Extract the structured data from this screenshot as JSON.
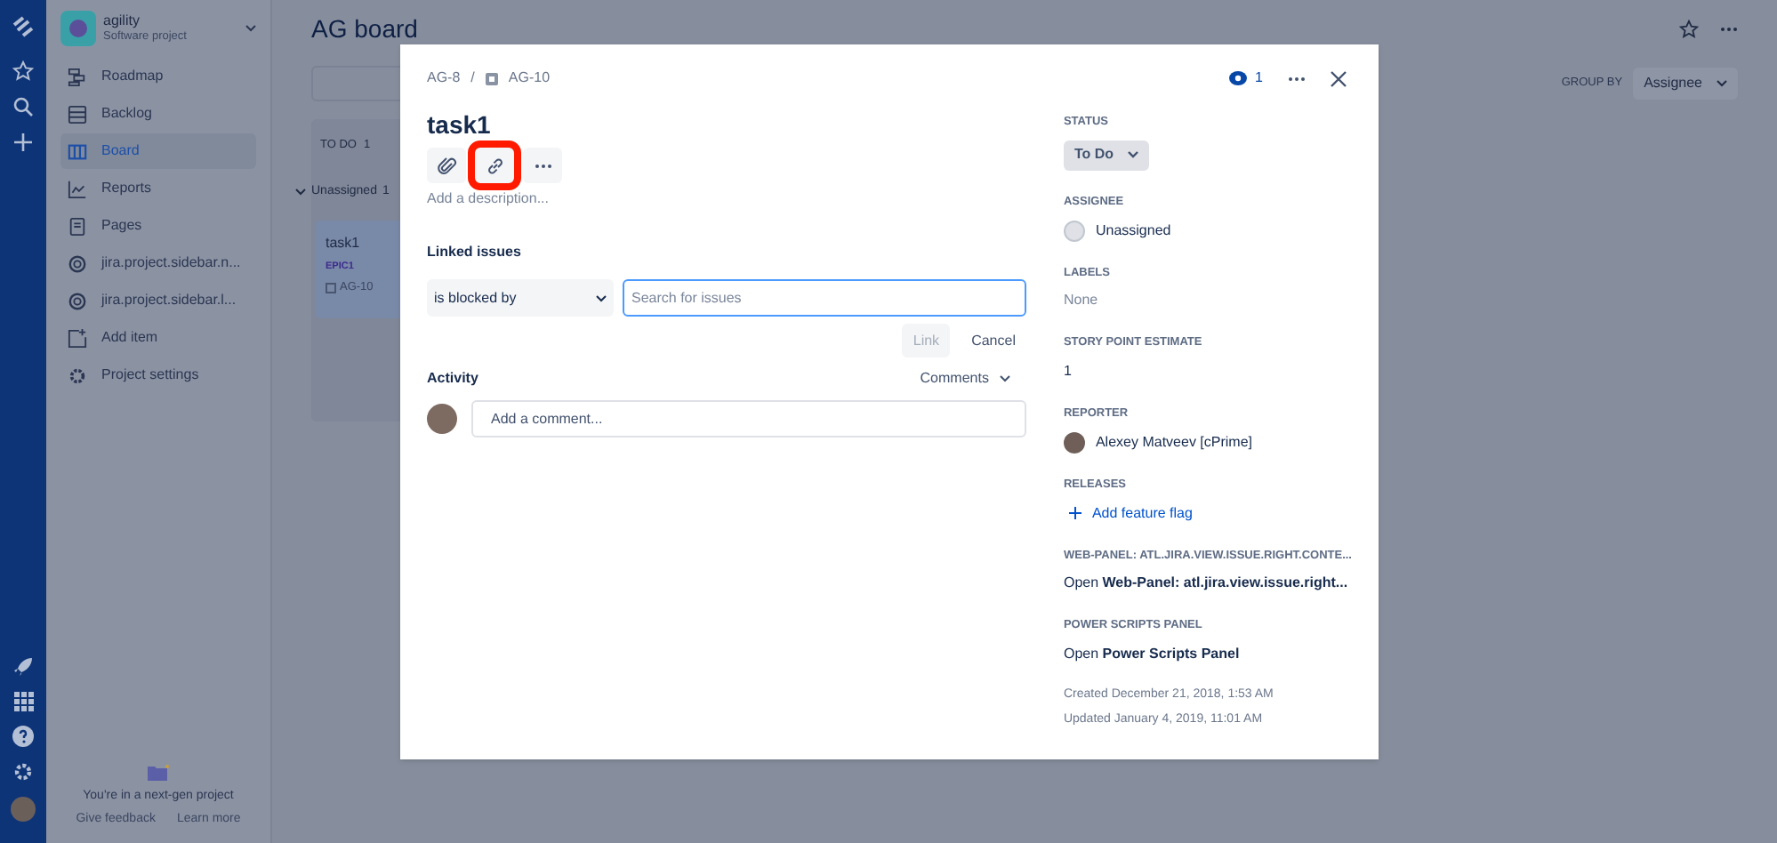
{
  "sidebar": {
    "project": {
      "name": "agility",
      "type": "Software project"
    },
    "items": [
      {
        "label": "Roadmap",
        "selected": false
      },
      {
        "label": "Backlog",
        "selected": false
      },
      {
        "label": "Board",
        "selected": true
      },
      {
        "label": "Reports",
        "selected": false
      },
      {
        "label": "Pages",
        "selected": false
      },
      {
        "label": "jira.project.sidebar.n...",
        "selected": false
      },
      {
        "label": "jira.project.sidebar.l...",
        "selected": false
      },
      {
        "label": "Add item",
        "selected": false
      },
      {
        "label": "Project settings",
        "selected": false
      }
    ],
    "footer": {
      "message": "You're in a next-gen project",
      "links": [
        "Give feedback",
        "Learn more"
      ]
    }
  },
  "board": {
    "title": "AG board",
    "group_by": {
      "label": "GROUP BY",
      "value": "Assignee"
    },
    "column": {
      "title": "TO DO",
      "count": "1"
    },
    "group": {
      "label": "Unassigned",
      "count": "1",
      "expanded": true
    },
    "card": {
      "title": "task1",
      "epic": "EPIC1",
      "key": "AG-10"
    }
  },
  "issue": {
    "breadcrumbs": [
      "AG-8",
      "AG-10"
    ],
    "breadcrumb_separator": "/",
    "watchers": "1",
    "title": "task1",
    "actions": [
      {
        "kind": "attach",
        "highlighted": false
      },
      {
        "kind": "link",
        "highlighted": true
      },
      {
        "kind": "more",
        "highlighted": false
      }
    ],
    "description_placeholder": "Add a description...",
    "linked_issues": {
      "heading": "Linked issues",
      "relation": "is blocked by",
      "search_placeholder": "Search for issues",
      "buttons": [
        {
          "label": "Link",
          "disabled": true
        },
        {
          "label": "Cancel",
          "disabled": false
        }
      ]
    },
    "activity": {
      "heading": "Activity",
      "filter": "Comments",
      "comment_placeholder": "Add a comment..."
    },
    "fields": [
      {
        "kind": "status",
        "label": "STATUS",
        "value": "To Do"
      },
      {
        "kind": "user",
        "label": "ASSIGNEE",
        "value": "Unassigned",
        "assigned": false
      },
      {
        "kind": "empty",
        "label": "LABELS",
        "value": "None"
      },
      {
        "kind": "text",
        "label": "STORY POINT ESTIMATE",
        "value": "1"
      },
      {
        "kind": "user",
        "label": "REPORTER",
        "value": "Alexey Matveev [cPrime]",
        "assigned": true
      },
      {
        "kind": "add",
        "label": "RELEASES",
        "value": "Add feature flag"
      },
      {
        "kind": "open",
        "label": "WEB-PANEL: ATL.JIRA.VIEW.ISSUE.RIGHT.CONTE...",
        "value": "Open **Web-Panel: atl.jira.view.issue.right...**"
      },
      {
        "kind": "open",
        "label": "POWER SCRIPTS PANEL",
        "value": "Open **Power Scripts Panel**"
      }
    ],
    "created": "Created December 21, 2018, 1:53 AM",
    "updated": "Updated January 4, 2019, 11:01 AM"
  }
}
